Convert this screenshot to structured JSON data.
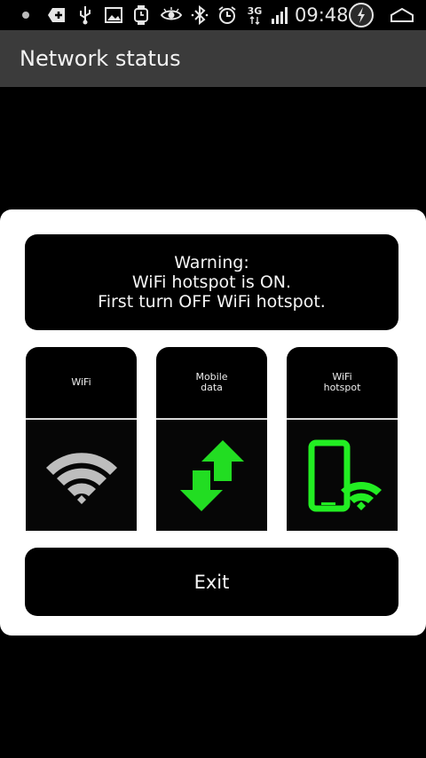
{
  "status_bar": {
    "time": "09:48",
    "network_type": "3G",
    "icons": [
      "notification-dot-icon",
      "plus-box-icon",
      "usb-icon",
      "image-icon",
      "watch-icon",
      "eye-icon",
      "bluetooth-icon",
      "alarm-icon",
      "network-3g-icon",
      "signal-icon",
      "battery-charging-icon",
      "home-icon"
    ]
  },
  "action_bar": {
    "title": "Network status"
  },
  "dialog": {
    "warning_lines": [
      "Warning:",
      "WiFi hotspot is ON.",
      "First turn OFF WiFi hotspot."
    ],
    "tiles": [
      {
        "label_lines": [
          "WiFi"
        ],
        "icon": "wifi-icon",
        "icon_color": "#bdbdbd"
      },
      {
        "label_lines": [
          "Mobile",
          "data"
        ],
        "icon": "mobile-data-arrows-icon",
        "icon_color": "#22dd22"
      },
      {
        "label_lines": [
          "WiFi",
          "hotspot"
        ],
        "icon": "phone-hotspot-icon",
        "icon_color": "#22ee22"
      }
    ],
    "exit_label": "Exit"
  },
  "colors": {
    "accent_green": "#22ee22",
    "dialog_bg": "#ffffff",
    "action_bar_bg": "#3b3b3b"
  }
}
